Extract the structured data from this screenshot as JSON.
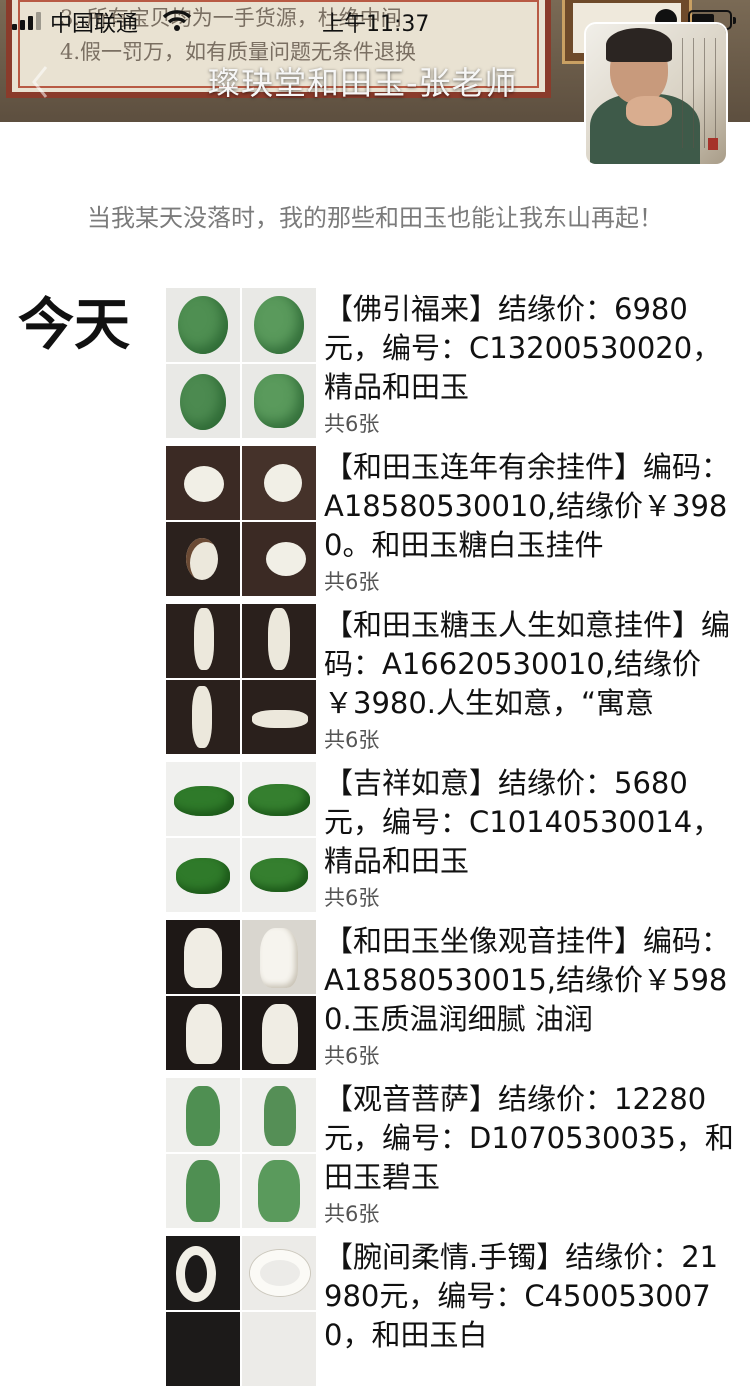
{
  "status_bar": {
    "carrier": "中国联通",
    "time": "上午11:37"
  },
  "cover": {
    "paper_line_1": "3. 所有宝贝均为一手货源，杜绝中间",
    "paper_line_2": "4.假一罚万，如有质量问题无条件退换",
    "title": "璨玦堂和田玉-张老师"
  },
  "profile": {
    "signature": "当我某天没落时，我的那些和田玉也能让我东山再起！"
  },
  "feed": {
    "day_label": "今天",
    "posts": [
      {
        "text": "【佛引福来】结缘价：6980元，编号：C13200530020，精品和田玉",
        "count": "共6张"
      },
      {
        "text": "【和田玉连年有余挂件】编码：A18580530010,结缘价￥3980。和田玉糖白玉挂件",
        "count": "共6张"
      },
      {
        "text": "【和田玉糖玉人生如意挂件】编码：A16620530010,结缘价￥3980.人生如意，“寓意",
        "count": "共6张"
      },
      {
        "text": "【吉祥如意】结缘价：5680元，编号：C10140530014，精品和田玉",
        "count": "共6张"
      },
      {
        "text": "【和田玉坐像观音挂件】编码：A18580530015,结缘价￥5980.玉质温润细腻 油润",
        "count": "共6张"
      },
      {
        "text": "【观音菩萨】结缘价：12280元，编号：D1070530035，和田玉碧玉",
        "count": "共6张"
      },
      {
        "text": "【腕间柔情.手镯】结缘价：21980元，编号：C4500530070，和田玉白",
        "count": ""
      }
    ]
  },
  "colors": {
    "jade_green": "#4f8f52",
    "white_jade": "#f1efe6",
    "cover_frame_red": "#8a3b2b"
  }
}
